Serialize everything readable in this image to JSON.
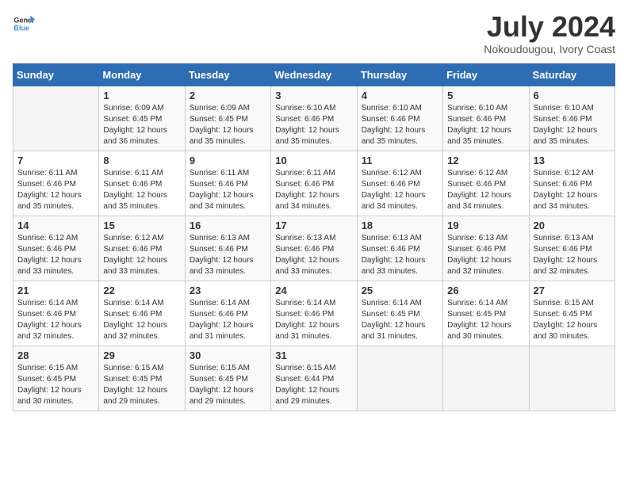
{
  "logo": {
    "line1": "General",
    "line2": "Blue"
  },
  "title": "July 2024",
  "location": "Nokoudougou, Ivory Coast",
  "weekdays": [
    "Sunday",
    "Monday",
    "Tuesday",
    "Wednesday",
    "Thursday",
    "Friday",
    "Saturday"
  ],
  "weeks": [
    [
      {
        "day": "",
        "info": ""
      },
      {
        "day": "1",
        "info": "Sunrise: 6:09 AM\nSunset: 6:45 PM\nDaylight: 12 hours\nand 36 minutes."
      },
      {
        "day": "2",
        "info": "Sunrise: 6:09 AM\nSunset: 6:45 PM\nDaylight: 12 hours\nand 35 minutes."
      },
      {
        "day": "3",
        "info": "Sunrise: 6:10 AM\nSunset: 6:46 PM\nDaylight: 12 hours\nand 35 minutes."
      },
      {
        "day": "4",
        "info": "Sunrise: 6:10 AM\nSunset: 6:46 PM\nDaylight: 12 hours\nand 35 minutes."
      },
      {
        "day": "5",
        "info": "Sunrise: 6:10 AM\nSunset: 6:46 PM\nDaylight: 12 hours\nand 35 minutes."
      },
      {
        "day": "6",
        "info": "Sunrise: 6:10 AM\nSunset: 6:46 PM\nDaylight: 12 hours\nand 35 minutes."
      }
    ],
    [
      {
        "day": "7",
        "info": "Sunrise: 6:11 AM\nSunset: 6:46 PM\nDaylight: 12 hours\nand 35 minutes."
      },
      {
        "day": "8",
        "info": "Sunrise: 6:11 AM\nSunset: 6:46 PM\nDaylight: 12 hours\nand 35 minutes."
      },
      {
        "day": "9",
        "info": "Sunrise: 6:11 AM\nSunset: 6:46 PM\nDaylight: 12 hours\nand 34 minutes."
      },
      {
        "day": "10",
        "info": "Sunrise: 6:11 AM\nSunset: 6:46 PM\nDaylight: 12 hours\nand 34 minutes."
      },
      {
        "day": "11",
        "info": "Sunrise: 6:12 AM\nSunset: 6:46 PM\nDaylight: 12 hours\nand 34 minutes."
      },
      {
        "day": "12",
        "info": "Sunrise: 6:12 AM\nSunset: 6:46 PM\nDaylight: 12 hours\nand 34 minutes."
      },
      {
        "day": "13",
        "info": "Sunrise: 6:12 AM\nSunset: 6:46 PM\nDaylight: 12 hours\nand 34 minutes."
      }
    ],
    [
      {
        "day": "14",
        "info": "Sunrise: 6:12 AM\nSunset: 6:46 PM\nDaylight: 12 hours\nand 33 minutes."
      },
      {
        "day": "15",
        "info": "Sunrise: 6:12 AM\nSunset: 6:46 PM\nDaylight: 12 hours\nand 33 minutes."
      },
      {
        "day": "16",
        "info": "Sunrise: 6:13 AM\nSunset: 6:46 PM\nDaylight: 12 hours\nand 33 minutes."
      },
      {
        "day": "17",
        "info": "Sunrise: 6:13 AM\nSunset: 6:46 PM\nDaylight: 12 hours\nand 33 minutes."
      },
      {
        "day": "18",
        "info": "Sunrise: 6:13 AM\nSunset: 6:46 PM\nDaylight: 12 hours\nand 33 minutes."
      },
      {
        "day": "19",
        "info": "Sunrise: 6:13 AM\nSunset: 6:46 PM\nDaylight: 12 hours\nand 32 minutes."
      },
      {
        "day": "20",
        "info": "Sunrise: 6:13 AM\nSunset: 6:46 PM\nDaylight: 12 hours\nand 32 minutes."
      }
    ],
    [
      {
        "day": "21",
        "info": "Sunrise: 6:14 AM\nSunset: 6:46 PM\nDaylight: 12 hours\nand 32 minutes."
      },
      {
        "day": "22",
        "info": "Sunrise: 6:14 AM\nSunset: 6:46 PM\nDaylight: 12 hours\nand 32 minutes."
      },
      {
        "day": "23",
        "info": "Sunrise: 6:14 AM\nSunset: 6:46 PM\nDaylight: 12 hours\nand 31 minutes."
      },
      {
        "day": "24",
        "info": "Sunrise: 6:14 AM\nSunset: 6:46 PM\nDaylight: 12 hours\nand 31 minutes."
      },
      {
        "day": "25",
        "info": "Sunrise: 6:14 AM\nSunset: 6:45 PM\nDaylight: 12 hours\nand 31 minutes."
      },
      {
        "day": "26",
        "info": "Sunrise: 6:14 AM\nSunset: 6:45 PM\nDaylight: 12 hours\nand 30 minutes."
      },
      {
        "day": "27",
        "info": "Sunrise: 6:15 AM\nSunset: 6:45 PM\nDaylight: 12 hours\nand 30 minutes."
      }
    ],
    [
      {
        "day": "28",
        "info": "Sunrise: 6:15 AM\nSunset: 6:45 PM\nDaylight: 12 hours\nand 30 minutes."
      },
      {
        "day": "29",
        "info": "Sunrise: 6:15 AM\nSunset: 6:45 PM\nDaylight: 12 hours\nand 29 minutes."
      },
      {
        "day": "30",
        "info": "Sunrise: 6:15 AM\nSunset: 6:45 PM\nDaylight: 12 hours\nand 29 minutes."
      },
      {
        "day": "31",
        "info": "Sunrise: 6:15 AM\nSunset: 6:44 PM\nDaylight: 12 hours\nand 29 minutes."
      },
      {
        "day": "",
        "info": ""
      },
      {
        "day": "",
        "info": ""
      },
      {
        "day": "",
        "info": ""
      }
    ]
  ]
}
